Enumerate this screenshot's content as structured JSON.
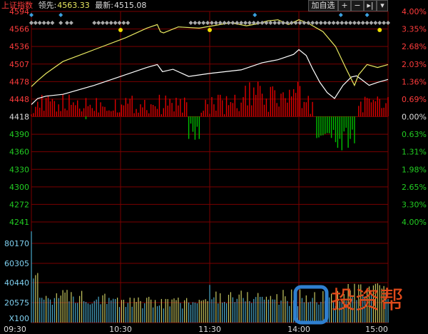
{
  "header": {
    "index_name": "上证指数",
    "lead_label": "领先:",
    "lead_value": "4563.33",
    "latest_label": "最新:",
    "latest_value": "4515.08"
  },
  "toolbar": {
    "add_watch_label": "加自选",
    "zoom_in_icon": "plus-icon",
    "zoom_out_icon": "minus-icon",
    "jump_end_icon": "skip-end-icon",
    "menu_icon": "chevron-down-icon"
  },
  "watermark": {
    "text": "投资帮"
  },
  "colors": {
    "up": "#e00000",
    "down": "#00c000",
    "grid": "#7a0000",
    "price_line": "#ffffff",
    "lead_line": "#e8e860",
    "volume": "#4aa8c8",
    "text_up": "#ff3c3c",
    "text_down": "#22cc22"
  },
  "chart_data": {
    "type": "line",
    "title": "上证指数",
    "x_ticks": [
      "09:30",
      "10:30",
      "11:30",
      "14:00",
      "15:00"
    ],
    "price_axis": {
      "ticks": [
        4594,
        4566,
        4536,
        4507,
        4478,
        4448,
        4418,
        4390,
        4360,
        4330,
        4300,
        4272,
        4241
      ],
      "ylim": [
        4241,
        4594
      ],
      "prev_close": 4418
    },
    "percent_axis": {
      "ticks": [
        "4.00%",
        "3.35%",
        "2.68%",
        "2.03%",
        "1.36%",
        "0.69%",
        "0.00%",
        "0.63%",
        "1.31%",
        "1.98%",
        "2.65%",
        "3.30%",
        "4.00%"
      ]
    },
    "volume_axis": {
      "ticks": [
        "80170",
        "60305",
        "40440",
        "20575"
      ],
      "unit_label": "X100",
      "ylim": [
        0,
        100000
      ]
    },
    "series": [
      {
        "name": "最新",
        "x": [
          0,
          6,
          14,
          30,
          60,
          90,
          110,
          120,
          125,
          135,
          150,
          170,
          200,
          220,
          235,
          250,
          255,
          262,
          268,
          275,
          282,
          289,
          297,
          305,
          310,
          316,
          322,
          330,
          340
        ],
        "values": [
          4438,
          4448,
          4452,
          4455,
          4470,
          4488,
          4500,
          4505,
          4493,
          4497,
          4485,
          4490,
          4496,
          4508,
          4513,
          4522,
          4530,
          4520,
          4498,
          4475,
          4458,
          4448,
          4470,
          4484,
          4486,
          4478,
          4470,
          4475,
          4480
        ]
      },
      {
        "name": "领先",
        "x": [
          0,
          6,
          14,
          30,
          60,
          90,
          110,
          120,
          123,
          126,
          140,
          160,
          190,
          205,
          215,
          225,
          235,
          245,
          255,
          265,
          278,
          290,
          300,
          308,
          312,
          320,
          330,
          340
        ],
        "values": [
          4468,
          4478,
          4490,
          4510,
          4530,
          4550,
          4566,
          4572,
          4560,
          4558,
          4568,
          4566,
          4575,
          4570,
          4573,
          4578,
          4580,
          4572,
          4580,
          4573,
          4560,
          4535,
          4498,
          4470,
          4488,
          4505,
          4500,
          4505
        ]
      }
    ],
    "ratio_bars_note": "red above / green below the 0.00% line",
    "markers": {
      "diamond_row_1": true,
      "diamond_row_2": true,
      "yellow_dots": true
    }
  }
}
